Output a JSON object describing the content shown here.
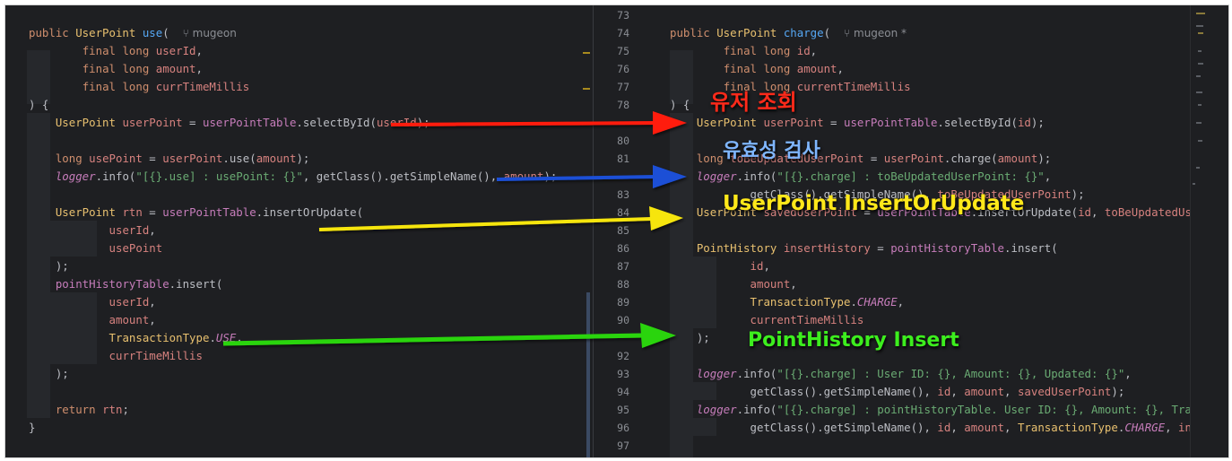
{
  "left": {
    "lines": [
      {
        "parts": [
          {
            "c": "kw",
            "t": "public "
          },
          {
            "c": "ty",
            "t": "UserPoint "
          },
          {
            "c": "fn",
            "t": "use"
          },
          {
            "t": "(  "
          },
          {
            "c": "au",
            "t": "⑂ mugeon"
          }
        ]
      },
      {
        "indent": "        ",
        "parts": [
          {
            "c": "kw",
            "t": "final long "
          },
          {
            "c": "pm",
            "t": "userId"
          },
          {
            "t": ","
          }
        ]
      },
      {
        "indent": "        ",
        "parts": [
          {
            "c": "kw",
            "t": "final long "
          },
          {
            "c": "pm",
            "t": "amount"
          },
          {
            "t": ","
          }
        ]
      },
      {
        "indent": "        ",
        "parts": [
          {
            "c": "kw",
            "t": "final long "
          },
          {
            "c": "pm",
            "t": "currTimeMillis"
          }
        ]
      },
      {
        "parts": [
          {
            "t": ") {"
          }
        ]
      },
      {
        "indent": "    ",
        "parts": [
          {
            "c": "ty",
            "t": "UserPoint "
          },
          {
            "c": "pm",
            "t": "userPoint"
          },
          {
            "t": " = "
          },
          {
            "c": "fl",
            "t": "userPointTable"
          },
          {
            "t": ".selectById("
          },
          {
            "c": "pm",
            "t": "userId"
          },
          {
            "t": ");"
          }
        ]
      },
      {
        "parts": []
      },
      {
        "indent": "    ",
        "parts": [
          {
            "c": "kw",
            "t": "long "
          },
          {
            "c": "pm",
            "t": "usePoint"
          },
          {
            "t": " = "
          },
          {
            "c": "pm",
            "t": "userPoint"
          },
          {
            "t": ".use("
          },
          {
            "c": "pm",
            "t": "amount"
          },
          {
            "t": ");"
          }
        ]
      },
      {
        "indent": "    ",
        "parts": [
          {
            "c": "lg",
            "t": "logger"
          },
          {
            "t": ".info("
          },
          {
            "c": "st",
            "t": "\"[{}.use] : usePoint: {}\""
          },
          {
            "t": ", getClass().getSimpleName(), "
          },
          {
            "c": "pm",
            "t": "amount"
          },
          {
            "t": ");"
          }
        ]
      },
      {
        "parts": []
      },
      {
        "indent": "    ",
        "parts": [
          {
            "c": "ty",
            "t": "UserPoint "
          },
          {
            "c": "pm",
            "t": "rtn"
          },
          {
            "t": " = "
          },
          {
            "c": "fl",
            "t": "userPointTable"
          },
          {
            "t": ".insertOrUpdate("
          }
        ]
      },
      {
        "indent": "            ",
        "parts": [
          {
            "c": "pm",
            "t": "userId"
          },
          {
            "t": ","
          }
        ]
      },
      {
        "indent": "            ",
        "parts": [
          {
            "c": "pm",
            "t": "usePoint"
          }
        ]
      },
      {
        "indent": "    ",
        "parts": [
          {
            "t": ");"
          }
        ]
      },
      {
        "indent": "    ",
        "parts": [
          {
            "c": "fl",
            "t": "pointHistoryTable"
          },
          {
            "t": ".insert("
          }
        ]
      },
      {
        "indent": "            ",
        "parts": [
          {
            "c": "pm",
            "t": "userId"
          },
          {
            "t": ","
          }
        ]
      },
      {
        "indent": "            ",
        "parts": [
          {
            "c": "pm",
            "t": "amount"
          },
          {
            "t": ","
          }
        ]
      },
      {
        "indent": "            ",
        "parts": [
          {
            "c": "ty",
            "t": "TransactionType"
          },
          {
            "t": "."
          },
          {
            "c": "cn",
            "t": "USE"
          },
          {
            "t": ","
          }
        ]
      },
      {
        "indent": "            ",
        "parts": [
          {
            "c": "pm",
            "t": "currTimeMillis"
          }
        ]
      },
      {
        "indent": "    ",
        "parts": [
          {
            "t": ");"
          }
        ]
      },
      {
        "parts": []
      },
      {
        "indent": "    ",
        "parts": [
          {
            "c": "kw",
            "t": "return "
          },
          {
            "c": "pm",
            "t": "rtn"
          },
          {
            "t": ";"
          }
        ]
      },
      {
        "parts": [
          {
            "t": "}"
          }
        ]
      }
    ]
  },
  "gutter": {
    "line_numbers": [
      "73",
      "74",
      "75",
      "76",
      "77",
      "78",
      "",
      "80",
      "81",
      "",
      "83",
      "84",
      "85",
      "86",
      "87",
      "88",
      "89",
      "90",
      "",
      "92",
      "93",
      "94",
      "95",
      "96",
      "97"
    ]
  },
  "right": {
    "lines": [
      {
        "parts": []
      },
      {
        "parts": [
          {
            "c": "kw",
            "t": "public "
          },
          {
            "c": "ty",
            "t": "UserPoint "
          },
          {
            "c": "fn",
            "t": "charge"
          },
          {
            "t": "(  "
          },
          {
            "c": "au",
            "t": "⑂ mugeon *"
          }
        ]
      },
      {
        "indent": "        ",
        "parts": [
          {
            "c": "kw",
            "t": "final long "
          },
          {
            "c": "pm",
            "t": "id"
          },
          {
            "t": ","
          }
        ]
      },
      {
        "indent": "        ",
        "parts": [
          {
            "c": "kw",
            "t": "final long "
          },
          {
            "c": "pm",
            "t": "amount"
          },
          {
            "t": ","
          }
        ]
      },
      {
        "indent": "        ",
        "parts": [
          {
            "c": "kw",
            "t": "final long "
          },
          {
            "c": "pm",
            "t": "currentTimeMillis"
          }
        ]
      },
      {
        "parts": [
          {
            "t": ") {"
          }
        ]
      },
      {
        "indent": "    ",
        "parts": [
          {
            "c": "ty",
            "t": "UserPoint "
          },
          {
            "c": "pm",
            "t": "userPoint"
          },
          {
            "t": " = "
          },
          {
            "c": "fl",
            "t": "userPointTable"
          },
          {
            "t": ".selectById("
          },
          {
            "c": "pm",
            "t": "id"
          },
          {
            "t": ");"
          }
        ]
      },
      {
        "parts": []
      },
      {
        "indent": "    ",
        "parts": [
          {
            "c": "kw",
            "t": "long "
          },
          {
            "c": "pm",
            "t": "toBeUpdatedUserPoint"
          },
          {
            "t": " = "
          },
          {
            "c": "pm",
            "t": "userPoint"
          },
          {
            "t": ".charge("
          },
          {
            "c": "pm",
            "t": "amount"
          },
          {
            "t": ");"
          }
        ]
      },
      {
        "indent": "    ",
        "parts": [
          {
            "c": "lg",
            "t": "logger"
          },
          {
            "t": ".info("
          },
          {
            "c": "st",
            "t": "\"[{}.charge] : toBeUpdatedUserPoint: {}\""
          },
          {
            "t": ","
          }
        ]
      },
      {
        "indent": "            ",
        "parts": [
          {
            "t": "getClass().getSimpleName(), "
          },
          {
            "c": "pm",
            "t": "toBeUpdatedUserPoint"
          },
          {
            "t": ");"
          }
        ]
      },
      {
        "indent": "    ",
        "parts": [
          {
            "c": "ty",
            "t": "UserPoint "
          },
          {
            "c": "pm",
            "t": "savedUserPoint"
          },
          {
            "t": " = "
          },
          {
            "c": "fl",
            "t": "userPointTable"
          },
          {
            "t": ".insertOrUpdate("
          },
          {
            "c": "pm",
            "t": "id"
          },
          {
            "t": ", "
          },
          {
            "c": "pm",
            "t": "toBeUpdatedUserPoint"
          },
          {
            "t": ");"
          }
        ]
      },
      {
        "parts": []
      },
      {
        "indent": "    ",
        "parts": [
          {
            "c": "ty",
            "t": "PointHistory "
          },
          {
            "c": "pm",
            "t": "insertHistory"
          },
          {
            "t": " = "
          },
          {
            "c": "fl",
            "t": "pointHistoryTable"
          },
          {
            "t": ".insert("
          }
        ]
      },
      {
        "indent": "            ",
        "parts": [
          {
            "c": "pm",
            "t": "id"
          },
          {
            "t": ","
          }
        ]
      },
      {
        "indent": "            ",
        "parts": [
          {
            "c": "pm",
            "t": "amount"
          },
          {
            "t": ","
          }
        ]
      },
      {
        "indent": "            ",
        "parts": [
          {
            "c": "ty",
            "t": "TransactionType"
          },
          {
            "t": "."
          },
          {
            "c": "cn",
            "t": "CHARGE"
          },
          {
            "t": ","
          }
        ]
      },
      {
        "indent": "            ",
        "parts": [
          {
            "c": "pm",
            "t": "currentTimeMillis"
          }
        ]
      },
      {
        "indent": "    ",
        "parts": [
          {
            "t": ");"
          }
        ]
      },
      {
        "parts": []
      },
      {
        "indent": "    ",
        "parts": [
          {
            "c": "lg",
            "t": "logger"
          },
          {
            "t": ".info("
          },
          {
            "c": "st",
            "t": "\"[{}.charge] : User ID: {}, Amount: {}, Updated: {}\""
          },
          {
            "t": ","
          }
        ]
      },
      {
        "indent": "            ",
        "parts": [
          {
            "t": "getClass().getSimpleName(), "
          },
          {
            "c": "pm",
            "t": "id"
          },
          {
            "t": ", "
          },
          {
            "c": "pm",
            "t": "amount"
          },
          {
            "t": ", "
          },
          {
            "c": "pm",
            "t": "savedUserPoint"
          },
          {
            "t": ");"
          }
        ]
      },
      {
        "indent": "    ",
        "parts": [
          {
            "c": "lg",
            "t": "logger"
          },
          {
            "t": ".info("
          },
          {
            "c": "st",
            "t": "\"[{}.charge] : pointHistoryTable. User ID: {}, Amount: {}, TransactionTyp"
          }
        ]
      },
      {
        "indent": "            ",
        "parts": [
          {
            "t": "getClass().getSimpleName(), "
          },
          {
            "c": "pm",
            "t": "id"
          },
          {
            "t": ", "
          },
          {
            "c": "pm",
            "t": "amount"
          },
          {
            "t": ", "
          },
          {
            "c": "ty",
            "t": "TransactionType"
          },
          {
            "t": "."
          },
          {
            "c": "cn",
            "t": "CHARGE"
          },
          {
            "t": ", "
          },
          {
            "c": "pm",
            "t": "insertHistory"
          }
        ]
      }
    ]
  },
  "annotations": [
    {
      "text": "유저 조회",
      "color": "#ff2a1a"
    },
    {
      "text": "유효성 검사",
      "color": "#7fb6ff"
    },
    {
      "text": "UserPoint InsertOrUpdate",
      "color": "#ffe81a"
    },
    {
      "text": "PointHistory Insert",
      "color": "#3dee1e"
    }
  ],
  "arrow_colors": [
    "#ff1a0e",
    "#1a4fd6",
    "#f6e50e",
    "#2bd40e"
  ]
}
